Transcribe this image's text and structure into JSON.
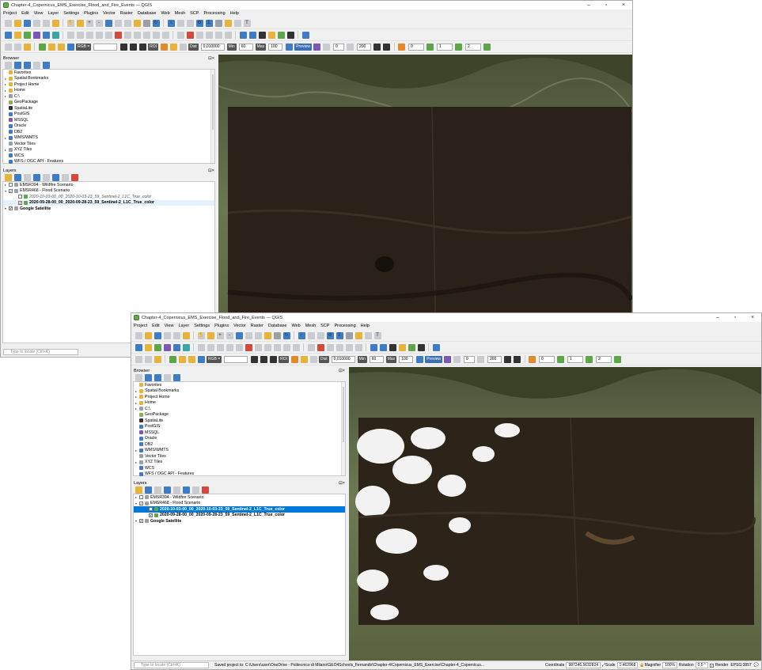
{
  "window1": {
    "title": "Chapter-4_Copernicus_EMS_Exercise_Flood_and_Fire_Events — QGIS",
    "menus": [
      "Project",
      "Edit",
      "View",
      "Layer",
      "Settings",
      "Plugins",
      "Vector",
      "Raster",
      "Database",
      "Web",
      "Mesh",
      "SCP",
      "Processing",
      "Help"
    ],
    "browser": {
      "title": "Browser",
      "items": [
        {
          "label": "Favorites",
          "arrow": "",
          "color": "#e7b33b"
        },
        {
          "label": "Spatial Bookmarks",
          "arrow": "▸",
          "color": "#e7b33b"
        },
        {
          "label": "Project Home",
          "arrow": "▸",
          "color": "#e7b33b"
        },
        {
          "label": "Home",
          "arrow": "▸",
          "color": "#e7b33b"
        },
        {
          "label": "C:\\",
          "arrow": "▸",
          "color": "#9aa0a6"
        },
        {
          "label": "GeoPackage",
          "arrow": "",
          "color": "#8ab34a"
        },
        {
          "label": "SpatiaLite",
          "arrow": "",
          "color": "#333333"
        },
        {
          "label": "PostGIS",
          "arrow": "",
          "color": "#3f7cc6"
        },
        {
          "label": "MSSQL",
          "arrow": "",
          "color": "#7b57b8"
        },
        {
          "label": "Oracle",
          "arrow": "",
          "color": "#3f7cc6"
        },
        {
          "label": "DB2",
          "arrow": "",
          "color": "#3f7cc6"
        },
        {
          "label": "WMS/WMTS",
          "arrow": "▸",
          "color": "#3f7cc6"
        },
        {
          "label": "Vector Tiles",
          "arrow": "",
          "color": "#9aa0a6"
        },
        {
          "label": "XYZ Tiles",
          "arrow": "▸",
          "color": "#9aa0a6"
        },
        {
          "label": "WCS",
          "arrow": "",
          "color": "#3f7cc6"
        },
        {
          "label": "WFS / OGC API - Features",
          "arrow": "",
          "color": "#3f7cc6"
        }
      ]
    },
    "layers": {
      "title": "Layers",
      "items": [
        {
          "label": "EMSR394 - Wildfire Scenario",
          "indent": 0,
          "arrow": "▸",
          "checked": false,
          "style": ""
        },
        {
          "label": "EMSR468 - Flood Scenario",
          "indent": 0,
          "arrow": "▾",
          "checked": true,
          "style": ""
        },
        {
          "label": "2020-10-03-00_00_2020-10-03-23_59_Sentinel-2_L1C_True_color",
          "indent": 1,
          "arrow": "",
          "checked": false,
          "style": "italic"
        },
        {
          "label": "2020-09-28-00_00_2020-09-28-23_59_Sentinel-2_L1C_True_color",
          "indent": 1,
          "arrow": "",
          "checked": true,
          "style": "bold lsel"
        },
        {
          "label": "Google Satellite",
          "indent": 0,
          "arrow": "▾",
          "checked": true,
          "style": "bold"
        }
      ]
    },
    "toolbar": {
      "rgb": "RGB =",
      "dist": "Dist",
      "dist_val": "0,010000",
      "min": "Min",
      "min_val": "60",
      "max": "Max",
      "max_val": "100",
      "preview": "Preview",
      "roi": "ROI",
      "v0": "0",
      "v200": "200",
      "v1": "1",
      "v2": "2"
    },
    "locate_placeholder": "Type to locate (Ctrl+K)"
  },
  "window2": {
    "title": "Chapter-4_Copernicus_EMS_Exercise_Flood_and_Fire_Events — QGIS",
    "layers": {
      "items": [
        {
          "label": "EMSR394 - Wildfire Scenario",
          "indent": 0,
          "arrow": "▸",
          "checked": false,
          "style": ""
        },
        {
          "label": "EMSR468 - Flood Scenario",
          "indent": 0,
          "arrow": "▾",
          "checked": true,
          "style": ""
        },
        {
          "label": "2020-10-03-00_00_2020-10-03-23_59_Sentinel-2_L1C_True_color",
          "indent": 1,
          "arrow": "",
          "checked": true,
          "style": "bold sel"
        },
        {
          "label": "2020-09-28-00_00_2020-09-28-23_59_Sentinel-2_L1C_True_color",
          "indent": 1,
          "arrow": "",
          "checked": true,
          "style": "bold"
        },
        {
          "label": "Google Satellite",
          "indent": 0,
          "arrow": "▾",
          "checked": true,
          "style": "bold"
        }
      ]
    },
    "status": {
      "locate_placeholder": "Type to locate (Ctrl+K)",
      "message": "Saved project to: C:\\Users\\user\\OneDrive - Politecnico di Milano\\GEO4Schools_Fernando\\Chapter-4\\Copernicus_EMS_Exercise\\Chapter-4_Copernicus...",
      "coord_label": "Coordinate",
      "coord_value": "987246,5632824",
      "scale_label": "Scale",
      "scale_value": "1:462968",
      "magnifier_label": "Magnifier",
      "magnifier_value": "100%",
      "rotation_label": "Rotation",
      "rotation_value": "0,0 °",
      "render_label": "Render",
      "crs": "EPSG:3857"
    }
  },
  "colors": {
    "selection": "#0078d7",
    "map_base": "#5f6b44"
  }
}
